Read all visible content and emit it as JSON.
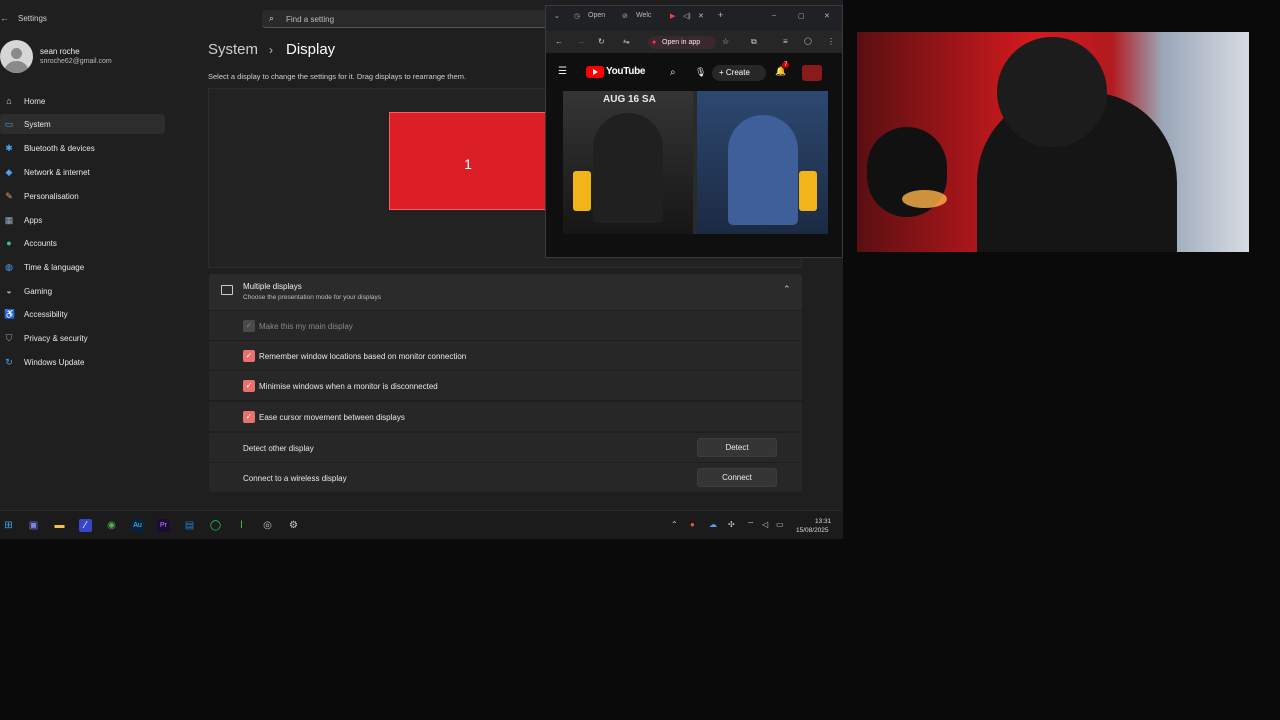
{
  "settings": {
    "window_title": "Settings",
    "search_placeholder": "Find a setting",
    "user": {
      "name": "sean roche",
      "email": "snroche62@gmail.com"
    },
    "nav": [
      {
        "label": "Home",
        "icon": "home-icon"
      },
      {
        "label": "System",
        "icon": "system-icon",
        "active": true
      },
      {
        "label": "Bluetooth & devices",
        "icon": "bluetooth-icon"
      },
      {
        "label": "Network & internet",
        "icon": "wifi-icon"
      },
      {
        "label": "Personalisation",
        "icon": "brush-icon"
      },
      {
        "label": "Apps",
        "icon": "apps-icon"
      },
      {
        "label": "Accounts",
        "icon": "person-icon"
      },
      {
        "label": "Time & language",
        "icon": "globe-icon"
      },
      {
        "label": "Gaming",
        "icon": "gamepad-icon"
      },
      {
        "label": "Accessibility",
        "icon": "accessibility-icon"
      },
      {
        "label": "Privacy & security",
        "icon": "shield-icon"
      },
      {
        "label": "Windows Update",
        "icon": "update-icon"
      }
    ],
    "breadcrumb": {
      "parent": "System",
      "separator": "›",
      "current": "Display"
    },
    "page_description": "Select a display to change the settings for it. Drag displays to rearrange them.",
    "monitor_label": "1",
    "multi_displays": {
      "title": "Multiple displays",
      "subtitle": "Choose the presentation mode for your displays"
    },
    "options": [
      {
        "label": "Make this my main display",
        "checked": true,
        "disabled": true
      },
      {
        "label": "Remember window locations based on monitor connection",
        "checked": true
      },
      {
        "label": "Minimise windows when a monitor is disconnected",
        "checked": true
      },
      {
        "label": "Ease cursor movement between displays",
        "checked": true
      }
    ],
    "detect": {
      "label": "Detect other display",
      "button": "Detect"
    },
    "wireless": {
      "label": "Connect to a wireless display",
      "button": "Connect"
    }
  },
  "taskbar": {
    "time": "13:31",
    "date": "15/08/2025"
  },
  "browser": {
    "tabs": [
      "Open",
      "Welc"
    ],
    "open_in_app": "Open in app",
    "youtube_label": "YouTube",
    "create_label": "Create",
    "notifications": "7",
    "video_text": "AUG 16 SA",
    "accent": "#ff0000"
  },
  "colors": {
    "accent": "#e8716e",
    "monitor": "#dc1f26"
  }
}
